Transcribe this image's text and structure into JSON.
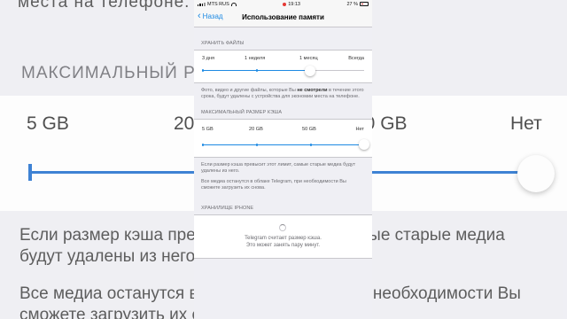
{
  "background": {
    "top_text": "места на телефоне.",
    "section_header": "МАКСИМАЛЬНЫЙ РАЗМЕР КЭША",
    "ticks": [
      "5 GB",
      "20 GB",
      "50 GB",
      "Нет"
    ],
    "paragraph1": [
      "Если размер кэша превысит этот лимит, самые старые медиа",
      "будут удалены из него."
    ],
    "paragraph2": [
      "Все медиа останутся в облаке Telegram, при необходимости Вы",
      "сможете загрузить их снова."
    ],
    "slider_value_fraction": 1.0
  },
  "status_bar": {
    "carrier": "MTS RUS",
    "time": "19:13",
    "battery": "27 %"
  },
  "nav": {
    "back_label": "Назад",
    "title": "Использование памяти"
  },
  "keep_media": {
    "header": "ХРАНИТЬ ФАЙЛЫ",
    "ticks": [
      "3 дня",
      "1 неделя",
      "1 месяц",
      "Всегда"
    ],
    "selected_index": 2,
    "note_pre": "Фото, видео и другие файлы, которые Вы ",
    "note_bold": "не смотрели",
    "note_post": " в течение этого срока, будут удалены с устройства для экономии места на телефоне."
  },
  "cache_size": {
    "header": "МАКСИМАЛЬНЫЙ РАЗМЕР КЭША",
    "ticks": [
      "5 GB",
      "20 GB",
      "50 GB",
      "Нет"
    ],
    "selected_index": 3,
    "note1": "Если размер кэша превысит этот лимит, самые старые медиа будут удалены из него.",
    "note2": "Все медиа останутся в облаке Telegram, при необходимости Вы сможете загрузить их снова."
  },
  "storage": {
    "header": "ХРАНИЛИЩЕ IPHONE",
    "line1": "Telegram считает размер кэша.",
    "line2": "Это может занять пару минут."
  },
  "colors": {
    "accent": "#1d8ae3",
    "background": "#efeff4",
    "secondary_text": "#6d6d72"
  }
}
